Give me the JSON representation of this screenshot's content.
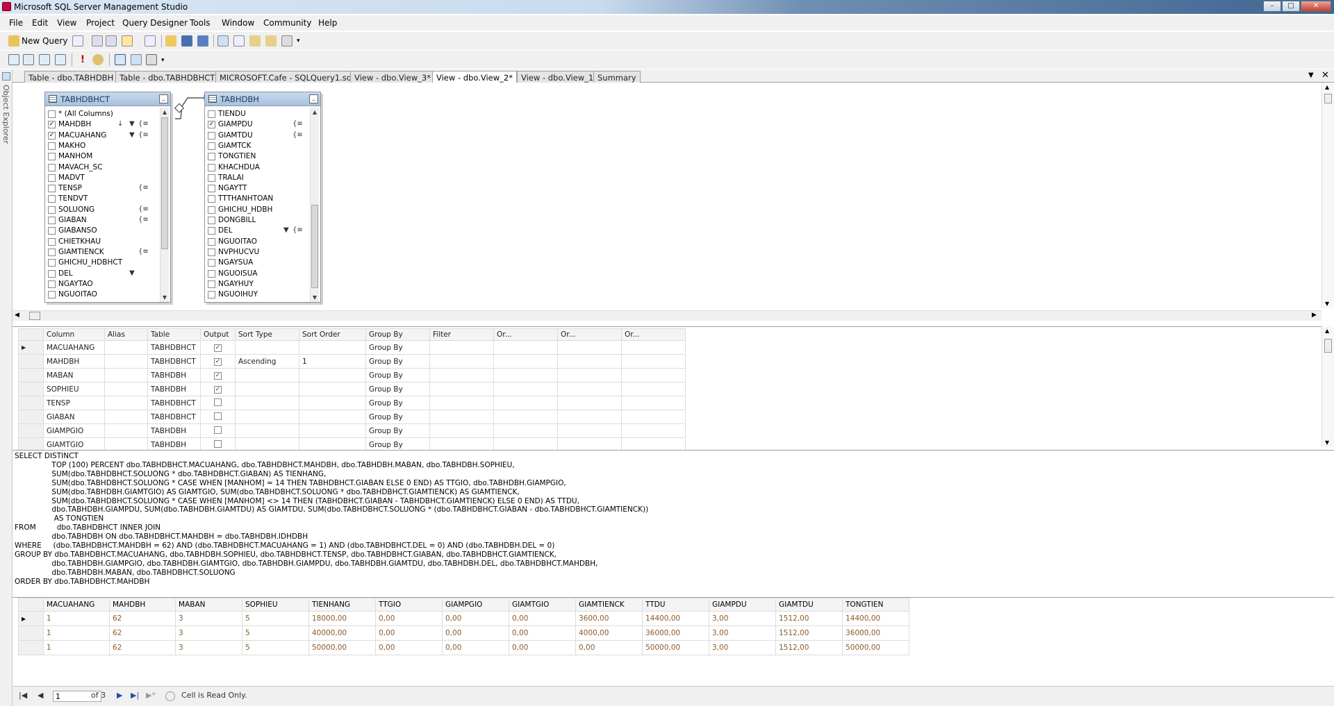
{
  "window": {
    "title": "Microsoft SQL Server Management Studio"
  },
  "menu": [
    "File",
    "Edit",
    "View",
    "Project",
    "Query Designer",
    "Tools",
    "Window",
    "Community",
    "Help"
  ],
  "toolbar": {
    "new_query_label": "New Query"
  },
  "left_rail": {
    "label": "Object Explorer"
  },
  "tabs": [
    {
      "label": "Table - dbo.TABHDBH",
      "active": false
    },
    {
      "label": "Table - dbo.TABHDBHCT",
      "active": false
    },
    {
      "label": "MICROSOFT.Cafe - SQLQuery1.sql",
      "active": false
    },
    {
      "label": "View - dbo.View_3*",
      "active": false
    },
    {
      "label": "View - dbo.View_2*",
      "active": true
    },
    {
      "label": "View - dbo.View_1*",
      "active": false
    },
    {
      "label": "Summary",
      "active": false
    }
  ],
  "diagram": {
    "table1": {
      "name": "TABHDBHCT",
      "columns": [
        {
          "name": "* (All Columns)",
          "checked": false
        },
        {
          "name": "MAHDBH",
          "checked": true
        },
        {
          "name": "MACUAHANG",
          "checked": true
        },
        {
          "name": "MAKHO",
          "checked": false
        },
        {
          "name": "MANHOM",
          "checked": false
        },
        {
          "name": "MAVACH_SC",
          "checked": false
        },
        {
          "name": "MADVT",
          "checked": false
        },
        {
          "name": "TENSP",
          "checked": false
        },
        {
          "name": "TENDVT",
          "checked": false
        },
        {
          "name": "SOLUONG",
          "checked": false
        },
        {
          "name": "GIABAN",
          "checked": false
        },
        {
          "name": "GIABANSO",
          "checked": false
        },
        {
          "name": "CHIETKHAU",
          "checked": false
        },
        {
          "name": "GIAMTIENCK",
          "checked": false
        },
        {
          "name": "GHICHU_HDBHCT",
          "checked": false
        },
        {
          "name": "DEL",
          "checked": false
        },
        {
          "name": "NGAYTAO",
          "checked": false
        },
        {
          "name": "NGUOITAO",
          "checked": false
        }
      ]
    },
    "table2": {
      "name": "TABHDBH",
      "columns": [
        {
          "name": "TIENDU",
          "checked": false
        },
        {
          "name": "GIAMPDU",
          "checked": true
        },
        {
          "name": "GIAMTDU",
          "checked": false
        },
        {
          "name": "GIAMTCK",
          "checked": false
        },
        {
          "name": "TONGTIEN",
          "checked": false
        },
        {
          "name": "KHACHDUA",
          "checked": false
        },
        {
          "name": "TRALAI",
          "checked": false
        },
        {
          "name": "NGAYTT",
          "checked": false
        },
        {
          "name": "TTTHANHTOAN",
          "checked": false
        },
        {
          "name": "GHICHU_HDBH",
          "checked": false
        },
        {
          "name": "DONGBILL",
          "checked": false
        },
        {
          "name": "DEL",
          "checked": false
        },
        {
          "name": "NGUOITAO",
          "checked": false
        },
        {
          "name": "NVPHUCVU",
          "checked": false
        },
        {
          "name": "NGAYSUA",
          "checked": false
        },
        {
          "name": "NGUOISUA",
          "checked": false
        },
        {
          "name": "NGAYHUY",
          "checked": false
        },
        {
          "name": "NGUOIHUY",
          "checked": false
        }
      ]
    }
  },
  "criteria": {
    "headers": [
      "Column",
      "Alias",
      "Table",
      "Output",
      "Sort Type",
      "Sort Order",
      "Group By",
      "Filter",
      "Or...",
      "Or...",
      "Or..."
    ],
    "rows": [
      {
        "column": "MACUAHANG",
        "alias": "",
        "table": "TABHDBHCT",
        "output": true,
        "sort_type": "",
        "sort_order": "",
        "group_by": "Group By"
      },
      {
        "column": "MAHDBH",
        "alias": "",
        "table": "TABHDBHCT",
        "output": true,
        "sort_type": "Ascending",
        "sort_order": "1",
        "group_by": "Group By"
      },
      {
        "column": "MABAN",
        "alias": "",
        "table": "TABHDBH",
        "output": true,
        "sort_type": "",
        "sort_order": "",
        "group_by": "Group By"
      },
      {
        "column": "SOPHIEU",
        "alias": "",
        "table": "TABHDBH",
        "output": true,
        "sort_type": "",
        "sort_order": "",
        "group_by": "Group By"
      },
      {
        "column": "TENSP",
        "alias": "",
        "table": "TABHDBHCT",
        "output": false,
        "sort_type": "",
        "sort_order": "",
        "group_by": "Group By"
      },
      {
        "column": "GIABAN",
        "alias": "",
        "table": "TABHDBHCT",
        "output": false,
        "sort_type": "",
        "sort_order": "",
        "group_by": "Group By"
      },
      {
        "column": "GIAMPGIO",
        "alias": "",
        "table": "TABHDBH",
        "output": false,
        "sort_type": "",
        "sort_order": "",
        "group_by": "Group By"
      },
      {
        "column": "GIAMTGIO",
        "alias": "",
        "table": "TABHDBH",
        "output": false,
        "sort_type": "",
        "sort_order": "",
        "group_by": "Group By"
      }
    ]
  },
  "sql": [
    "SELECT DISTINCT",
    "                TOP (100) PERCENT dbo.TABHDBHCT.MACUAHANG, dbo.TABHDBHCT.MAHDBH, dbo.TABHDBH.MABAN, dbo.TABHDBH.SOPHIEU,",
    "                SUM(dbo.TABHDBHCT.SOLUONG * dbo.TABHDBHCT.GIABAN) AS TIENHANG,",
    "                SUM(dbo.TABHDBHCT.SOLUONG * CASE WHEN [MANHOM] = 14 THEN TABHDBHCT.GIABAN ELSE 0 END) AS TTGIO, dbo.TABHDBH.GIAMPGIO,",
    "                SUM(dbo.TABHDBH.GIAMTGIO) AS GIAMTGIO, SUM(dbo.TABHDBHCT.SOLUONG * dbo.TABHDBHCT.GIAMTIENCK) AS GIAMTIENCK,",
    "                SUM(dbo.TABHDBHCT.SOLUONG * CASE WHEN [MANHOM] <> 14 THEN (TABHDBHCT.GIABAN - TABHDBHCT.GIAMTIENCK) ELSE 0 END) AS TTDU,",
    "                dbo.TABHDBH.GIAMPDU, SUM(dbo.TABHDBH.GIAMTDU) AS GIAMTDU, SUM(dbo.TABHDBHCT.SOLUONG * (dbo.TABHDBHCT.GIABAN - dbo.TABHDBHCT.GIAMTIENCK))",
    "                 AS TONGTIEN",
    "FROM         dbo.TABHDBHCT INNER JOIN",
    "                dbo.TABHDBH ON dbo.TABHDBHCT.MAHDBH = dbo.TABHDBH.IDHDBH",
    "WHERE     (dbo.TABHDBHCT.MAHDBH = 62) AND (dbo.TABHDBHCT.MACUAHANG = 1) AND (dbo.TABHDBHCT.DEL = 0) AND (dbo.TABHDBH.DEL = 0)",
    "GROUP BY dbo.TABHDBHCT.MACUAHANG, dbo.TABHDBH.SOPHIEU, dbo.TABHDBHCT.TENSP, dbo.TABHDBHCT.GIABAN, dbo.TABHDBHCT.GIAMTIENCK,",
    "                dbo.TABHDBH.GIAMPGIO, dbo.TABHDBH.GIAMTGIO, dbo.TABHDBH.GIAMPDU, dbo.TABHDBH.GIAMTDU, dbo.TABHDBH.DEL, dbo.TABHDBHCT.MAHDBH,",
    "                dbo.TABHDBH.MABAN, dbo.TABHDBHCT.SOLUONG",
    "ORDER BY dbo.TABHDBHCT.MAHDBH"
  ],
  "results": {
    "headers": [
      "MACUAHANG",
      "MAHDBH",
      "MABAN",
      "SOPHIEU",
      "TIENHANG",
      "TTGIO",
      "GIAMPGIO",
      "GIAMTGIO",
      "GIAMTIENCK",
      "TTDU",
      "GIAMPDU",
      "GIAMTDU",
      "TONGTIEN"
    ],
    "rows": [
      [
        "1",
        "62",
        "3",
        "5",
        "18000,00",
        "0,00",
        "0,00",
        "0,00",
        "3600,00",
        "14400,00",
        "3,00",
        "1512,00",
        "14400,00"
      ],
      [
        "1",
        "62",
        "3",
        "5",
        "40000,00",
        "0,00",
        "0,00",
        "0,00",
        "4000,00",
        "36000,00",
        "3,00",
        "1512,00",
        "36000,00"
      ],
      [
        "1",
        "62",
        "3",
        "5",
        "50000,00",
        "0,00",
        "0,00",
        "0,00",
        "0,00",
        "50000,00",
        "3,00",
        "1512,00",
        "50000,00"
      ]
    ]
  },
  "navigator": {
    "current": "1",
    "of_label": "of 3",
    "status": "Cell is Read Only."
  }
}
